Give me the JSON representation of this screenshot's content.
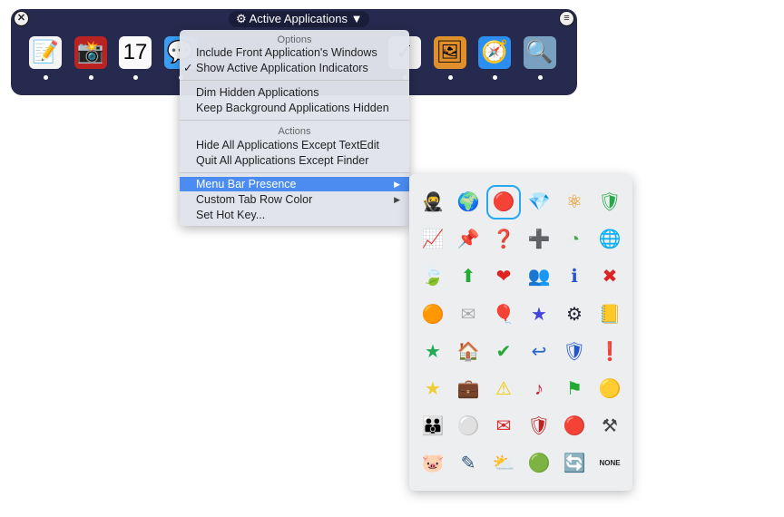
{
  "dock": {
    "title": "Active Applications",
    "gear_icon": "gear-icon",
    "dropdown_icon": "triangle-down-icon",
    "apps": [
      {
        "name": "textedit",
        "glyph": "📝",
        "color": "#f4f4f4"
      },
      {
        "name": "photo-booth",
        "glyph": "📸",
        "color": "#b22"
      },
      {
        "name": "calendar",
        "glyph": "17",
        "color": "#fafafa"
      },
      {
        "name": "messages",
        "glyph": "💬",
        "color": "#3a9ef5"
      },
      {
        "name": "hidden-1",
        "glyph": "",
        "color": "transparent"
      },
      {
        "name": "hidden-2",
        "glyph": "",
        "color": "transparent"
      },
      {
        "name": "hidden-3",
        "glyph": "",
        "color": "transparent"
      },
      {
        "name": "hidden-4",
        "glyph": "",
        "color": "transparent"
      },
      {
        "name": "script-editor",
        "glyph": "✓",
        "color": "#f2f2f2"
      },
      {
        "name": "preview-pen",
        "glyph": "🖼",
        "color": "#e0902a"
      },
      {
        "name": "safari",
        "glyph": "🧭",
        "color": "#2a8ff0"
      },
      {
        "name": "preview",
        "glyph": "🔍",
        "color": "#7aa0c0"
      }
    ]
  },
  "menu": {
    "options_header": "Options",
    "include_front": "Include Front Application's Windows",
    "show_indicators": "Show Active Application Indicators",
    "check": "✓",
    "dim_hidden": "Dim Hidden Applications",
    "keep_hidden": "Keep Background Applications Hidden",
    "actions_header": "Actions",
    "hide_all": "Hide All Applications Except TextEdit",
    "quit_all": "Quit All Applications Except Finder",
    "menu_bar_presence": "Menu Bar Presence",
    "custom_tab_color": "Custom Tab Row Color",
    "set_hot_key": "Set Hot Key...",
    "submenu_arrow": "▶"
  },
  "icon_picker": {
    "selected": "red-orb",
    "none_label": "NONE",
    "icons": [
      [
        "ninja",
        "#111",
        "🥷"
      ],
      [
        "globe",
        "#2a7",
        "🌍"
      ],
      [
        "red-orb",
        "#c22",
        "🔴"
      ],
      [
        "diamond",
        "#a8f",
        "💎"
      ],
      [
        "atom",
        "#e80",
        "⚛"
      ],
      [
        "green-shield",
        "#2a4",
        "🛡"
      ],
      [
        "chart",
        "#5ae",
        "📈"
      ],
      [
        "pushpin",
        "#26c",
        "📌"
      ],
      [
        "help",
        "#26c",
        "❓"
      ],
      [
        "plus",
        "#f80",
        "➕"
      ],
      [
        "pie-chart",
        "#4a4",
        "◔"
      ],
      [
        "globe-dark",
        "#333",
        "🌐"
      ],
      [
        "leaf",
        "#4a3",
        "🍃"
      ],
      [
        "up-arrow",
        "#2a3",
        "⬆"
      ],
      [
        "heart",
        "#d22",
        "❤"
      ],
      [
        "users",
        "#d33",
        "👥"
      ],
      [
        "info",
        "#25c",
        "ℹ"
      ],
      [
        "close-x",
        "#d22",
        "✖"
      ],
      [
        "orange-orb",
        "#f80",
        "🟠"
      ],
      [
        "envelope",
        "#aaa",
        "✉"
      ],
      [
        "balloons",
        "#d35",
        "🎈"
      ],
      [
        "star-blue",
        "#44d",
        "★"
      ],
      [
        "settings",
        "#223",
        "⚙"
      ],
      [
        "address-book",
        "#c72",
        "📒"
      ],
      [
        "star-green",
        "#2a5",
        "★"
      ],
      [
        "home",
        "#d22",
        "🏠"
      ],
      [
        "checkmark",
        "#2a3",
        "✔"
      ],
      [
        "reply",
        "#26c",
        "↩"
      ],
      [
        "blue-shield",
        "#25c",
        "🛡"
      ],
      [
        "alert-bubble",
        "#26c",
        "❗"
      ],
      [
        "star-yellow",
        "#ec3",
        "★"
      ],
      [
        "briefcase",
        "#c72",
        "💼"
      ],
      [
        "warning",
        "#ec0",
        "⚠"
      ],
      [
        "music-note",
        "#c23",
        "♪"
      ],
      [
        "flag",
        "#2a3",
        "⚑"
      ],
      [
        "yellow-orb",
        "#ed2",
        "🟡"
      ],
      [
        "people",
        "#c33",
        "👪"
      ],
      [
        "white-orb",
        "#ccc",
        "⚪"
      ],
      [
        "mail-red",
        "#d22",
        "✉"
      ],
      [
        "red-shield",
        "#b22",
        "🛡"
      ],
      [
        "red-orb-2",
        "#d22",
        "🔴"
      ],
      [
        "tools",
        "#444",
        "⚒"
      ],
      [
        "piggy-bank",
        "#e8a",
        "🐷"
      ],
      [
        "edit",
        "#357",
        "✎"
      ],
      [
        "weather",
        "#fa2",
        "⛅"
      ],
      [
        "green-orb",
        "#2a3",
        "🟢"
      ],
      [
        "refresh",
        "#26c",
        "🔄"
      ]
    ]
  }
}
